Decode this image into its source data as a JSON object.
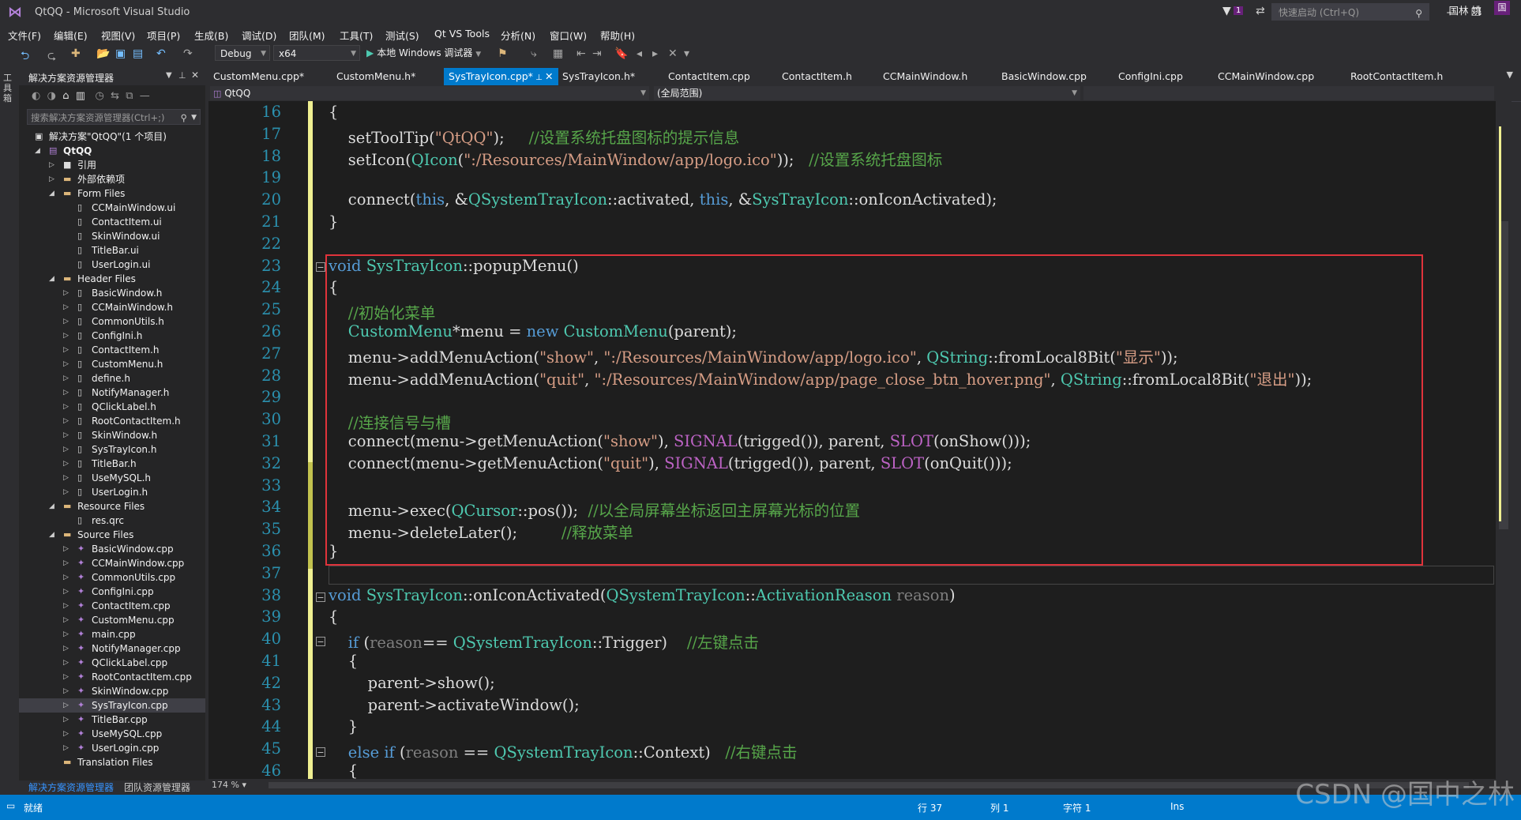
{
  "window": {
    "title": "QtQQ - Microsoft Visual Studio",
    "logo": "vs-logo-icon",
    "notification_count": "1",
    "quick_launch_placeholder": "快速启动 (Ctrl+Q)",
    "user": "国林 姚",
    "avatar": "国"
  },
  "menu": [
    "文件(F)",
    "编辑(E)",
    "视图(V)",
    "项目(P)",
    "生成(B)",
    "调试(D)",
    "团队(M)",
    "工具(T)",
    "测试(S)",
    "Qt VS Tools",
    "分析(N)",
    "窗口(W)",
    "帮助(H)"
  ],
  "toolbar": {
    "config": "Debug",
    "platform": "x64",
    "start_debug": "本地 Windows 调试器"
  },
  "left_strip_label": "工具箱",
  "solution_explorer": {
    "title": "解决方案资源管理器",
    "search_placeholder": "搜索解决方案资源管理器(Ctrl+;)",
    "tabs": [
      "解决方案资源管理器",
      "团队资源管理器"
    ],
    "tree": [
      {
        "label": "解决方案\"QtQQ\"(1 个项目)",
        "level": 0,
        "expand": "",
        "icon": "solution-icon"
      },
      {
        "label": "QtQQ",
        "level": 1,
        "expand": "◢",
        "icon": "project-icon"
      },
      {
        "label": "引用",
        "level": 2,
        "expand": "▷",
        "icon": "references-icon"
      },
      {
        "label": "外部依赖项",
        "level": 2,
        "expand": "▷",
        "icon": "folder-icon"
      },
      {
        "label": "Form Files",
        "level": 2,
        "expand": "◢",
        "icon": "folder-icon"
      },
      {
        "label": "CCMainWindow.ui",
        "level": 3,
        "expand": "",
        "icon": "file-icon"
      },
      {
        "label": "ContactItem.ui",
        "level": 3,
        "expand": "",
        "icon": "file-icon"
      },
      {
        "label": "SkinWindow.ui",
        "level": 3,
        "expand": "",
        "icon": "file-icon"
      },
      {
        "label": "TitleBar.ui",
        "level": 3,
        "expand": "",
        "icon": "file-icon"
      },
      {
        "label": "UserLogin.ui",
        "level": 3,
        "expand": "",
        "icon": "file-icon"
      },
      {
        "label": "Header Files",
        "level": 2,
        "expand": "◢",
        "icon": "folder-icon"
      },
      {
        "label": "BasicWindow.h",
        "level": 3,
        "expand": "▷",
        "icon": "header-file-icon"
      },
      {
        "label": "CCMainWindow.h",
        "level": 3,
        "expand": "▷",
        "icon": "header-file-icon"
      },
      {
        "label": "CommonUtils.h",
        "level": 3,
        "expand": "▷",
        "icon": "header-file-icon"
      },
      {
        "label": "ConfigIni.h",
        "level": 3,
        "expand": "▷",
        "icon": "header-file-icon"
      },
      {
        "label": "ContactItem.h",
        "level": 3,
        "expand": "▷",
        "icon": "header-file-icon"
      },
      {
        "label": "CustomMenu.h",
        "level": 3,
        "expand": "▷",
        "icon": "header-file-icon"
      },
      {
        "label": "define.h",
        "level": 3,
        "expand": "▷",
        "icon": "header-file-icon"
      },
      {
        "label": "NotifyManager.h",
        "level": 3,
        "expand": "▷",
        "icon": "header-file-icon"
      },
      {
        "label": "QClickLabel.h",
        "level": 3,
        "expand": "▷",
        "icon": "header-file-icon"
      },
      {
        "label": "RootContactItem.h",
        "level": 3,
        "expand": "▷",
        "icon": "header-file-icon"
      },
      {
        "label": "SkinWindow.h",
        "level": 3,
        "expand": "▷",
        "icon": "header-file-icon"
      },
      {
        "label": "SysTrayIcon.h",
        "level": 3,
        "expand": "▷",
        "icon": "header-file-icon"
      },
      {
        "label": "TitleBar.h",
        "level": 3,
        "expand": "▷",
        "icon": "header-file-icon"
      },
      {
        "label": "UseMySQL.h",
        "level": 3,
        "expand": "▷",
        "icon": "header-file-icon"
      },
      {
        "label": "UserLogin.h",
        "level": 3,
        "expand": "▷",
        "icon": "header-file-icon"
      },
      {
        "label": "Resource Files",
        "level": 2,
        "expand": "◢",
        "icon": "folder-icon"
      },
      {
        "label": "res.qrc",
        "level": 3,
        "expand": "",
        "icon": "file-icon"
      },
      {
        "label": "Source Files",
        "level": 2,
        "expand": "◢",
        "icon": "folder-icon"
      },
      {
        "label": "BasicWindow.cpp",
        "level": 3,
        "expand": "▷",
        "icon": "cpp-file-icon"
      },
      {
        "label": "CCMainWindow.cpp",
        "level": 3,
        "expand": "▷",
        "icon": "cpp-file-icon"
      },
      {
        "label": "CommonUtils.cpp",
        "level": 3,
        "expand": "▷",
        "icon": "cpp-file-icon"
      },
      {
        "label": "ConfigIni.cpp",
        "level": 3,
        "expand": "▷",
        "icon": "cpp-file-icon"
      },
      {
        "label": "ContactItem.cpp",
        "level": 3,
        "expand": "▷",
        "icon": "cpp-file-icon"
      },
      {
        "label": "CustomMenu.cpp",
        "level": 3,
        "expand": "▷",
        "icon": "cpp-file-icon"
      },
      {
        "label": "main.cpp",
        "level": 3,
        "expand": "▷",
        "icon": "cpp-file-icon"
      },
      {
        "label": "NotifyManager.cpp",
        "level": 3,
        "expand": "▷",
        "icon": "cpp-file-icon"
      },
      {
        "label": "QClickLabel.cpp",
        "level": 3,
        "expand": "▷",
        "icon": "cpp-file-icon"
      },
      {
        "label": "RootContactItem.cpp",
        "level": 3,
        "expand": "▷",
        "icon": "cpp-file-icon"
      },
      {
        "label": "SkinWindow.cpp",
        "level": 3,
        "expand": "▷",
        "icon": "cpp-file-icon"
      },
      {
        "label": "SysTrayIcon.cpp",
        "level": 3,
        "expand": "▷",
        "icon": "cpp-file-icon",
        "selected": true
      },
      {
        "label": "TitleBar.cpp",
        "level": 3,
        "expand": "▷",
        "icon": "cpp-file-icon"
      },
      {
        "label": "UseMySQL.cpp",
        "level": 3,
        "expand": "▷",
        "icon": "cpp-file-icon"
      },
      {
        "label": "UserLogin.cpp",
        "level": 3,
        "expand": "▷",
        "icon": "cpp-file-icon"
      },
      {
        "label": "Translation Files",
        "level": 2,
        "expand": "",
        "icon": "folder-icon"
      }
    ]
  },
  "tabs": [
    {
      "label": "CustomMenu.cpp*",
      "active": false
    },
    {
      "label": "CustomMenu.h*",
      "active": false
    },
    {
      "label": "SysTrayIcon.cpp*",
      "active": true
    },
    {
      "label": "SysTrayIcon.h*",
      "active": false
    },
    {
      "label": "ContactItem.cpp",
      "active": false
    },
    {
      "label": "ContactItem.h",
      "active": false
    },
    {
      "label": "CCMainWindow.h",
      "active": false
    },
    {
      "label": "BasicWindow.cpp",
      "active": false
    },
    {
      "label": "ConfigIni.cpp",
      "active": false
    },
    {
      "label": "CCMainWindow.cpp",
      "active": false
    },
    {
      "label": "RootContactItem.h",
      "active": false
    }
  ],
  "navbar": {
    "project": "QtQQ",
    "scope": "(全局范围)"
  },
  "code_lines": [
    {
      "n": "16",
      "tokens": [
        [
          "p",
          "{"
        ]
      ]
    },
    {
      "n": "17",
      "tokens": [
        [
          "p",
          "    setToolTip("
        ],
        [
          "st",
          "\"QtQQ\""
        ],
        [
          "p",
          ");     "
        ],
        [
          "cm",
          "//设置系统托盘图标的提示信息"
        ]
      ]
    },
    {
      "n": "18",
      "tokens": [
        [
          "p",
          "    setIcon("
        ],
        [
          "ty",
          "QIcon"
        ],
        [
          "p",
          "("
        ],
        [
          "st",
          "\":/Resources/MainWindow/app/logo.ico\""
        ],
        [
          "p",
          "));   "
        ],
        [
          "cm",
          "//设置系统托盘图标"
        ]
      ]
    },
    {
      "n": "19",
      "tokens": []
    },
    {
      "n": "20",
      "tokens": [
        [
          "p",
          "    connect("
        ],
        [
          "kw",
          "this"
        ],
        [
          "p",
          ", &"
        ],
        [
          "ty",
          "QSystemTrayIcon"
        ],
        [
          "p",
          "::activated, "
        ],
        [
          "kw",
          "this"
        ],
        [
          "p",
          ", &"
        ],
        [
          "ty",
          "SysTrayIcon"
        ],
        [
          "p",
          "::onIconActivated);"
        ]
      ]
    },
    {
      "n": "21",
      "tokens": [
        [
          "p",
          "}"
        ]
      ]
    },
    {
      "n": "22",
      "tokens": []
    },
    {
      "n": "23",
      "tokens": [
        [
          "kw",
          "void "
        ],
        [
          "ty",
          "SysTrayIcon"
        ],
        [
          "p",
          "::popupMenu()"
        ]
      ]
    },
    {
      "n": "24",
      "tokens": [
        [
          "p",
          "{"
        ]
      ]
    },
    {
      "n": "25",
      "tokens": [
        [
          "cm",
          "    //初始化菜单"
        ]
      ]
    },
    {
      "n": "26",
      "tokens": [
        [
          "p",
          "    "
        ],
        [
          "ty",
          "CustomMenu"
        ],
        [
          "p",
          "*menu = "
        ],
        [
          "kw",
          "new "
        ],
        [
          "ty",
          "CustomMenu"
        ],
        [
          "p",
          "(parent);"
        ]
      ]
    },
    {
      "n": "27",
      "tokens": [
        [
          "p",
          "    menu->addMenuAction("
        ],
        [
          "st",
          "\"show\""
        ],
        [
          "p",
          ", "
        ],
        [
          "st",
          "\":/Resources/MainWindow/app/logo.ico\""
        ],
        [
          "p",
          ", "
        ],
        [
          "ty",
          "QString"
        ],
        [
          "p",
          "::fromLocal8Bit("
        ],
        [
          "st",
          "\"显示\""
        ],
        [
          "p",
          "));"
        ]
      ]
    },
    {
      "n": "28",
      "tokens": [
        [
          "p",
          "    menu->addMenuAction("
        ],
        [
          "st",
          "\"quit\""
        ],
        [
          "p",
          ", "
        ],
        [
          "st",
          "\":/Resources/MainWindow/app/page_close_btn_hover.png\""
        ],
        [
          "p",
          ", "
        ],
        [
          "ty",
          "QString"
        ],
        [
          "p",
          "::fromLocal8Bit("
        ],
        [
          "st",
          "\"退出\""
        ],
        [
          "p",
          "));"
        ]
      ]
    },
    {
      "n": "29",
      "tokens": []
    },
    {
      "n": "30",
      "tokens": [
        [
          "cm",
          "    //连接信号与槽"
        ]
      ]
    },
    {
      "n": "31",
      "tokens": [
        [
          "p",
          "    connect(menu->getMenuAction("
        ],
        [
          "st",
          "\"show\""
        ],
        [
          "p",
          "), "
        ],
        [
          "mc",
          "SIGNAL"
        ],
        [
          "p",
          "(trigged()), parent, "
        ],
        [
          "mc",
          "SLOT"
        ],
        [
          "p",
          "(onShow()));"
        ]
      ]
    },
    {
      "n": "32",
      "tokens": [
        [
          "p",
          "    connect(menu->getMenuAction("
        ],
        [
          "st",
          "\"quit\""
        ],
        [
          "p",
          "), "
        ],
        [
          "mc",
          "SIGNAL"
        ],
        [
          "p",
          "(trigged()), parent, "
        ],
        [
          "mc",
          "SLOT"
        ],
        [
          "p",
          "(onQuit()));"
        ]
      ]
    },
    {
      "n": "33",
      "tokens": []
    },
    {
      "n": "34",
      "tokens": [
        [
          "p",
          "    menu->exec("
        ],
        [
          "ty",
          "QCursor"
        ],
        [
          "p",
          "::pos());  "
        ],
        [
          "cm",
          "//以全局屏幕坐标返回主屏幕光标的位置"
        ]
      ]
    },
    {
      "n": "35",
      "tokens": [
        [
          "p",
          "    menu->deleteLater();         "
        ],
        [
          "cm",
          "//释放菜单"
        ]
      ]
    },
    {
      "n": "36",
      "tokens": [
        [
          "p",
          "}"
        ]
      ]
    },
    {
      "n": "37",
      "tokens": []
    },
    {
      "n": "38",
      "tokens": [
        [
          "kw",
          "void "
        ],
        [
          "ty",
          "SysTrayIcon"
        ],
        [
          "p",
          "::onIconActivated("
        ],
        [
          "ty",
          "QSystemTrayIcon"
        ],
        [
          "p",
          "::"
        ],
        [
          "ty",
          "ActivationReason "
        ],
        [
          "pm",
          "reason"
        ],
        [
          "p",
          ")"
        ]
      ]
    },
    {
      "n": "39",
      "tokens": [
        [
          "p",
          "{"
        ]
      ]
    },
    {
      "n": "40",
      "tokens": [
        [
          "p",
          "    "
        ],
        [
          "kw",
          "if "
        ],
        [
          "p",
          "("
        ],
        [
          "pm",
          "reason"
        ],
        [
          "p",
          "== "
        ],
        [
          "ty",
          "QSystemTrayIcon"
        ],
        [
          "p",
          "::Trigger)    "
        ],
        [
          "cm",
          "//左键点击"
        ]
      ]
    },
    {
      "n": "41",
      "tokens": [
        [
          "p",
          "    {"
        ]
      ]
    },
    {
      "n": "42",
      "tokens": [
        [
          "p",
          "        parent->show();"
        ]
      ]
    },
    {
      "n": "43",
      "tokens": [
        [
          "p",
          "        parent->activateWindow();"
        ]
      ]
    },
    {
      "n": "44",
      "tokens": [
        [
          "p",
          "    }"
        ]
      ]
    },
    {
      "n": "45",
      "tokens": [
        [
          "p",
          "    "
        ],
        [
          "kw",
          "else if "
        ],
        [
          "p",
          "("
        ],
        [
          "pm",
          "reason"
        ],
        [
          "p",
          " == "
        ],
        [
          "ty",
          "QSystemTrayIcon"
        ],
        [
          "p",
          "::Context)   "
        ],
        [
          "cm",
          "//右键点击"
        ]
      ]
    },
    {
      "n": "46",
      "tokens": [
        [
          "p",
          "    {"
        ]
      ]
    }
  ],
  "editor": {
    "zoom": "174 %"
  },
  "status": {
    "ready": "就绪",
    "line": "行 37",
    "col": "列 1",
    "char": "字符 1",
    "mode": "Ins"
  },
  "watermark": "CSDN @国中之林",
  "colors": {
    "accent": "#007acc",
    "highlight_box": "#e0333b",
    "keyword": "#569cd6",
    "type": "#4ec9b0",
    "string": "#d69d85",
    "comment": "#57a64a",
    "macro": "#bd63c5"
  }
}
